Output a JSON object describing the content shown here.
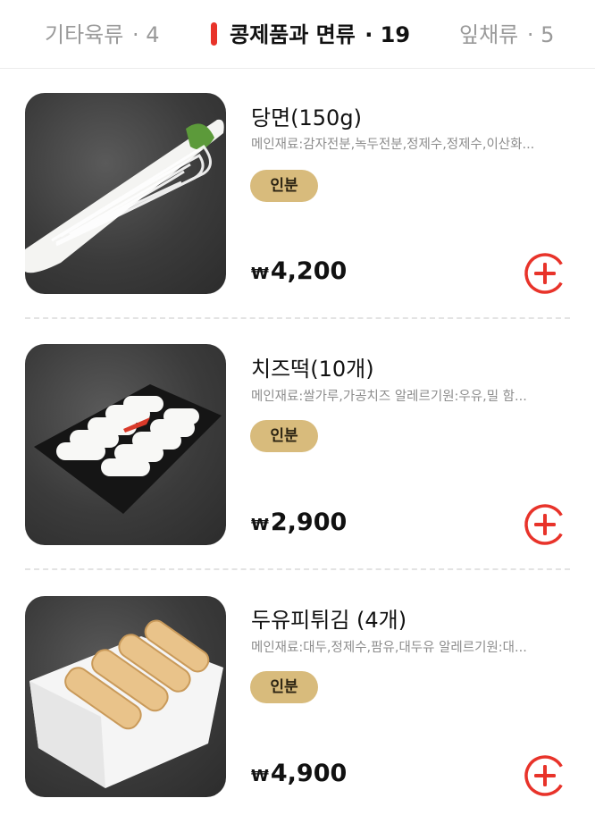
{
  "tabs": [
    {
      "label": "기타육류",
      "count": "· 4",
      "active": false
    },
    {
      "label": "콩제품과 면류",
      "count": "· 19",
      "active": true
    },
    {
      "label": "잎채류",
      "count": "· 5",
      "active": false
    }
  ],
  "colors": {
    "accent": "#e8332a",
    "badge": "#d8bb7c"
  },
  "products": [
    {
      "name": "당면(150g)",
      "description": "메인재료:감자전분,녹두전분,정제수,정제수,이산화...",
      "badge": "인분",
      "currency": "₩",
      "price": "4,200",
      "icon": "glass-noodles-image"
    },
    {
      "name": "치즈떡(10개)",
      "description": "메인재료:쌀가루,가공치즈 알레르기원:우유,밀 함...",
      "badge": "인분",
      "currency": "₩",
      "price": "2,900",
      "icon": "cheese-rice-cake-image"
    },
    {
      "name": "두유피튀김 (4개)",
      "description": "메인재료:대두,정제수,팜유,대두유 알레르기원:대...",
      "badge": "인분",
      "currency": "₩",
      "price": "4,900",
      "icon": "fried-tofu-skin-image"
    }
  ],
  "add_icon": "plus-circle-icon"
}
